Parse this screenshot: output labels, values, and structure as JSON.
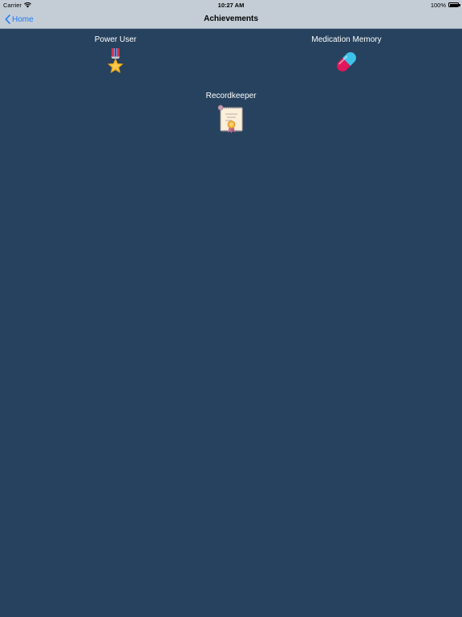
{
  "status_bar": {
    "carrier": "Carrier",
    "time": "10:27 AM",
    "battery_percent": "100%",
    "battery_level": 1.0,
    "icons": [
      "wifi-icon",
      "battery-icon"
    ]
  },
  "nav": {
    "back_label": "Home",
    "title": "Achievements"
  },
  "achievements": [
    {
      "label": "Power User",
      "icon": "medal-icon"
    },
    {
      "label": "Medication Memory",
      "icon": "pill-icon"
    },
    {
      "label": "Recordkeeper",
      "icon": "certificate-icon"
    }
  ],
  "colors": {
    "background": "#26425E",
    "bar": "#C4CDD6",
    "accent": "#1E7BF5",
    "text": "#FFFFFF"
  }
}
